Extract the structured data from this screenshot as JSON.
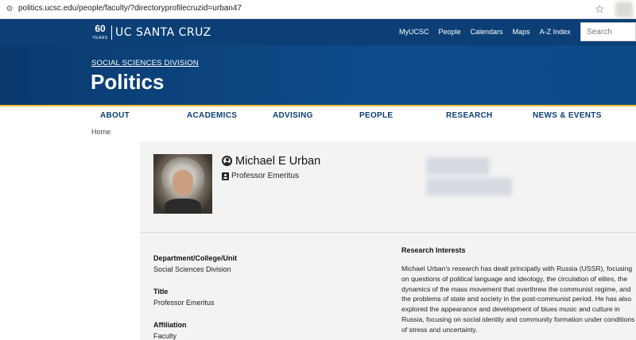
{
  "browser": {
    "url": "politics.ucsc.edu/people/faculty/?directoryprofilecruzid=urban47"
  },
  "topnav": {
    "logo_number": "60",
    "logo_years": "YEARS",
    "logo_text": "UC SANTA CRUZ",
    "links": [
      "MyUCSC",
      "People",
      "Calendars",
      "Maps",
      "A-Z Index"
    ],
    "search_placeholder": "Search"
  },
  "hero": {
    "division": "SOCIAL SCIENCES DIVISION",
    "title": "Politics"
  },
  "mainnav": {
    "items": [
      "ABOUT",
      "ACADEMICS",
      "ADVISING",
      "PEOPLE",
      "RESEARCH",
      "NEWS & EVENTS"
    ]
  },
  "breadcrumb": {
    "home": "Home"
  },
  "profile": {
    "name": "Michael E Urban",
    "title": "Professor Emeritus",
    "fields": [
      {
        "label": "Department/College/Unit",
        "value": "Social Sciences Division"
      },
      {
        "label": "Title",
        "value": "Professor Emeritus"
      },
      {
        "label": "Affiliation",
        "value": "Faculty"
      }
    ],
    "research_heading": "Research Interests",
    "research_text": "Michael Urban's research has dealt principally with Russia (USSR), focusing on questions of political language and ideology, the circulation of elites, the dynamics of the mass movement that overthrew the communist regime, and the problems of state and society in the post-communist period. He has also explored the appearance and development of blues music and culture in Russia, focusing on social identity and community formation under conditions of stress and uncertainty."
  }
}
